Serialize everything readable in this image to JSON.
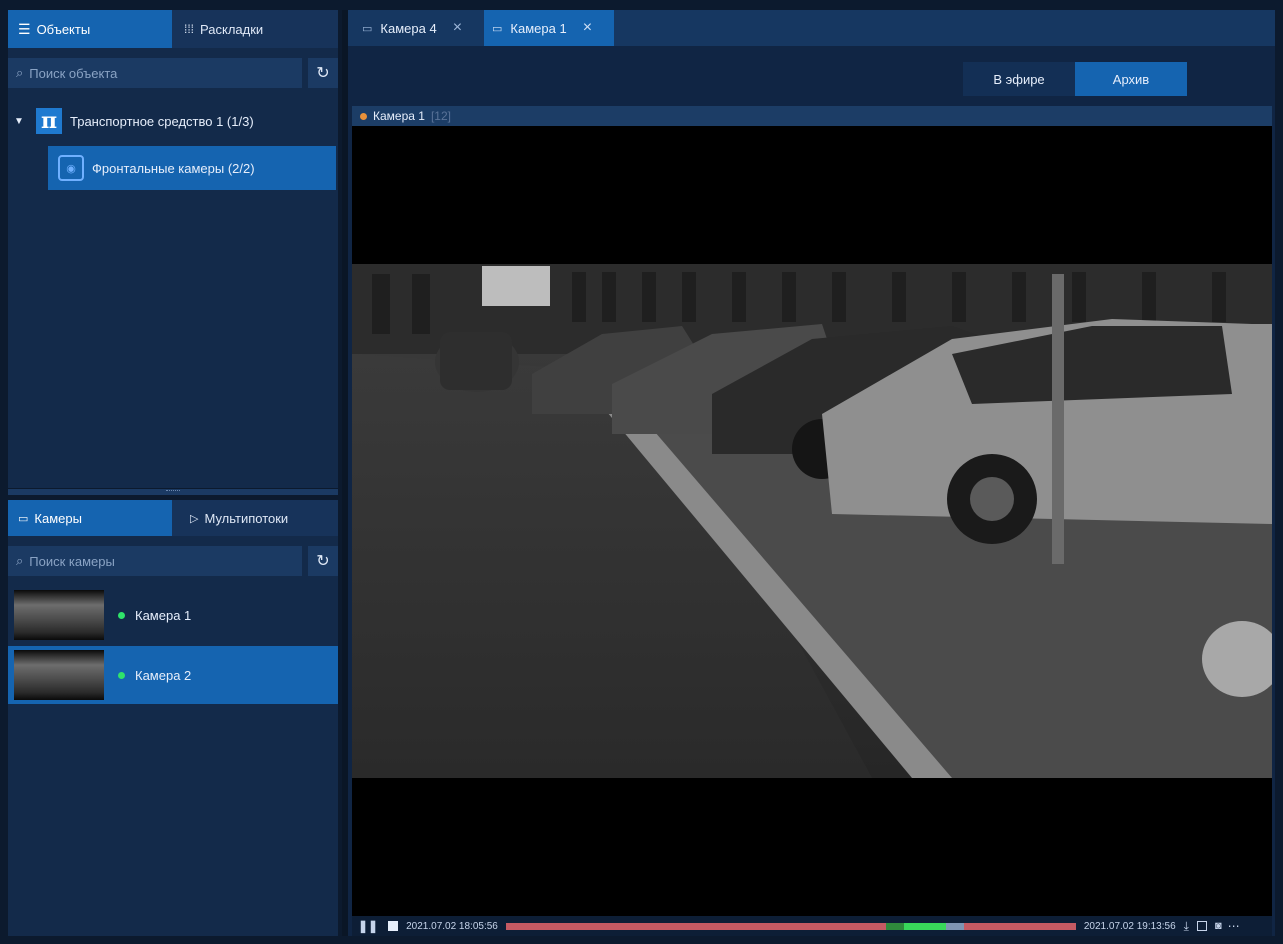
{
  "left_panel": {
    "tabs": [
      {
        "label": "Объекты",
        "icon": "list-icon"
      },
      {
        "label": "Раскладки",
        "icon": "grid-icon"
      }
    ],
    "object_search": {
      "placeholder": "Поиск объекта"
    },
    "tree": {
      "root": {
        "label": "Транспортное средство 1 (1/3)",
        "icon": "pi-icon"
      },
      "child": {
        "label": "Фронтальные камеры (2/2)",
        "icon": "camera-group-icon"
      }
    },
    "camera_tabs": [
      {
        "label": "Камеры",
        "icon": "camera-icon"
      },
      {
        "label": "Мультипотоки",
        "icon": "play-icon"
      }
    ],
    "camera_search": {
      "placeholder": "Поиск камеры"
    },
    "cameras": [
      {
        "label": "Камера 1",
        "status": "online"
      },
      {
        "label": "Камера 2",
        "status": "online"
      }
    ]
  },
  "top_tabs": [
    {
      "label": "Камера 4",
      "icon": "camera-icon",
      "close": "×"
    },
    {
      "label": "Камера 1",
      "icon": "camera-icon",
      "close": "×"
    }
  ],
  "view_switch": {
    "live": "В эфире",
    "archive": "Архив"
  },
  "player": {
    "title": "Камера 1",
    "id": "[12]",
    "time_start": "2021.07.02 18:05:56",
    "time_end": "2021.07.02 19:13:56"
  },
  "colors": {
    "accent": "#1564b0",
    "bg": "#0c1a2e",
    "panel": "#132a4a",
    "online": "#2fe36a",
    "timeline": "#c55a63"
  }
}
